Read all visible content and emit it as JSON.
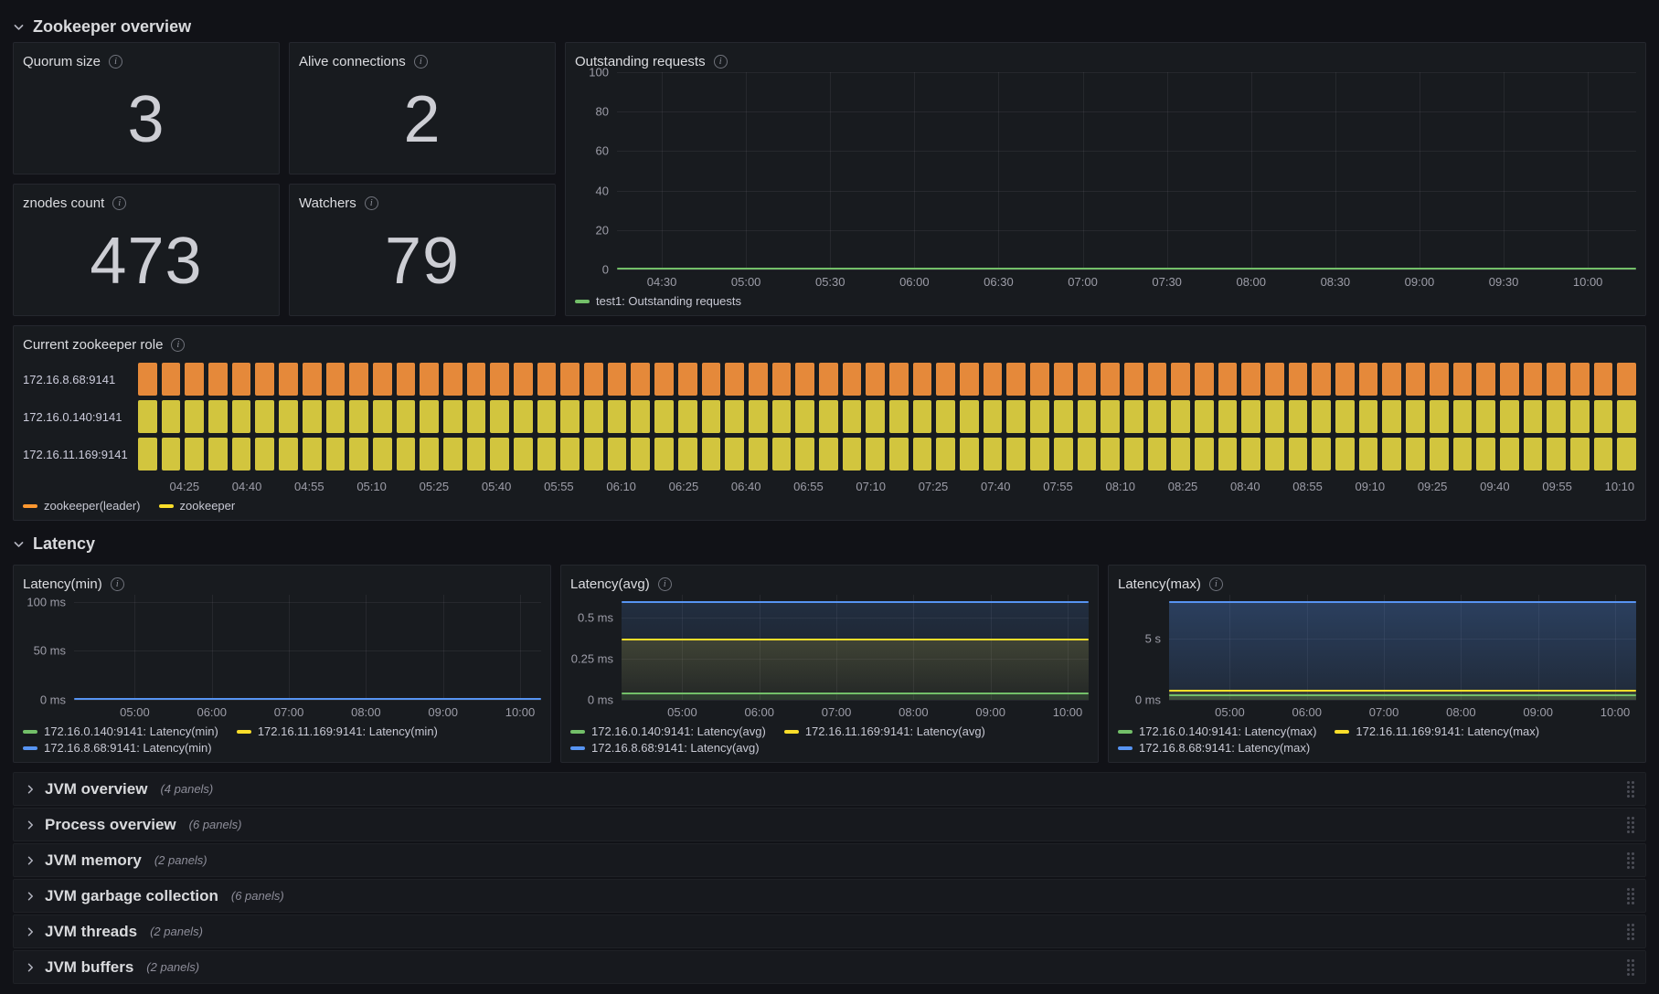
{
  "theme": {
    "background": "#111217",
    "panel_background": "#181b1f",
    "panel_border": "#25272e",
    "text_primary": "#ccccdc",
    "text_secondary": "#9d9da8",
    "grid_line": "rgba(204,204,220,0.08)",
    "series_green": "#73bf69",
    "series_yellow": "#fade2a",
    "series_orange": "#ff9830",
    "series_blue": "#5794f2"
  },
  "sections": {
    "overview": {
      "label": "Zookeeper overview"
    },
    "latency": {
      "label": "Latency"
    }
  },
  "stat_panels": [
    {
      "title": "Quorum size",
      "value": "3"
    },
    {
      "title": "Alive connections",
      "value": "2"
    },
    {
      "title": "znodes count",
      "value": "473"
    },
    {
      "title": "Watchers",
      "value": "79"
    }
  ],
  "outstanding_requests": {
    "title": "Outstanding requests",
    "y_ticks": [
      "100",
      "80",
      "60",
      "40",
      "20",
      "0"
    ],
    "x_ticks": [
      "04:30",
      "05:00",
      "05:30",
      "06:00",
      "06:30",
      "07:00",
      "07:30",
      "08:00",
      "08:30",
      "09:00",
      "09:30",
      "10:00"
    ],
    "legend": [
      {
        "label": "test1: Outstanding requests",
        "color": "#73bf69"
      }
    ],
    "chart_data": {
      "type": "line",
      "ylim": [
        0,
        100
      ],
      "series": [
        {
          "name": "test1: Outstanding requests",
          "value": 0
        }
      ]
    }
  },
  "zookeeper_role": {
    "title": "Current zookeeper role",
    "rows": [
      {
        "label": "172.16.8.68:9141",
        "state": "zookeeper(leader)",
        "fill": "#e5893a"
      },
      {
        "label": "172.16.0.140:9141",
        "state": "zookeeper",
        "fill": "#d2c53e"
      },
      {
        "label": "172.16.11.169:9141",
        "state": "zookeeper",
        "fill": "#d2c53e"
      }
    ],
    "x_ticks": [
      "04:25",
      "04:40",
      "04:55",
      "05:10",
      "05:25",
      "05:40",
      "05:55",
      "06:10",
      "06:25",
      "06:40",
      "06:55",
      "07:10",
      "07:25",
      "07:40",
      "07:55",
      "08:10",
      "08:25",
      "08:40",
      "08:55",
      "09:10",
      "09:25",
      "09:40",
      "09:55",
      "10:10"
    ],
    "legend": [
      {
        "label": "zookeeper(leader)",
        "color": "#ff9830"
      },
      {
        "label": "zookeeper",
        "color": "#fade2a"
      }
    ],
    "chart_data": {
      "type": "state-timeline",
      "states": [
        {
          "series": "172.16.8.68:9141",
          "state": "zookeeper(leader)"
        },
        {
          "series": "172.16.0.140:9141",
          "state": "zookeeper"
        },
        {
          "series": "172.16.11.169:9141",
          "state": "zookeeper"
        }
      ]
    }
  },
  "latency_min": {
    "title": "Latency(min)",
    "y_ticks": [
      "100 ms",
      "50 ms",
      "0 ms"
    ],
    "x_ticks": [
      "05:00",
      "06:00",
      "07:00",
      "08:00",
      "09:00",
      "10:00"
    ],
    "legend": [
      {
        "label": "172.16.0.140:9141: Latency(min)",
        "color": "#73bf69"
      },
      {
        "label": "172.16.11.169:9141: Latency(min)",
        "color": "#fade2a"
      },
      {
        "label": "172.16.8.68:9141: Latency(min)",
        "color": "#5794f2"
      }
    ],
    "chart_data": {
      "type": "line",
      "unit": "ms",
      "ylim": [
        0,
        100
      ],
      "series": [
        {
          "name": "172.16.0.140:9141",
          "value": 0
        },
        {
          "name": "172.16.11.169:9141",
          "value": 0
        },
        {
          "name": "172.16.8.68:9141",
          "value": 0
        }
      ]
    }
  },
  "latency_avg": {
    "title": "Latency(avg)",
    "y_ticks": [
      "0.5 ms",
      "0.25 ms",
      "0 ms"
    ],
    "x_ticks": [
      "05:00",
      "06:00",
      "07:00",
      "08:00",
      "09:00",
      "10:00"
    ],
    "legend": [
      {
        "label": "172.16.0.140:9141: Latency(avg)",
        "color": "#73bf69"
      },
      {
        "label": "172.16.11.169:9141: Latency(avg)",
        "color": "#fade2a"
      },
      {
        "label": "172.16.8.68:9141: Latency(avg)",
        "color": "#5794f2"
      }
    ],
    "chart_data": {
      "type": "line",
      "unit": "ms",
      "series": [
        {
          "name": "172.16.0.140:9141",
          "value": 0.03
        },
        {
          "name": "172.16.11.169:9141",
          "value": 0.37
        },
        {
          "name": "172.16.8.68:9141",
          "value": 0.58
        }
      ]
    }
  },
  "latency_max": {
    "title": "Latency(max)",
    "y_ticks": [
      "5 s",
      "0 ms"
    ],
    "x_ticks": [
      "05:00",
      "06:00",
      "07:00",
      "08:00",
      "09:00",
      "10:00"
    ],
    "legend": [
      {
        "label": "172.16.0.140:9141: Latency(max)",
        "color": "#73bf69"
      },
      {
        "label": "172.16.11.169:9141: Latency(max)",
        "color": "#fade2a"
      },
      {
        "label": "172.16.8.68:9141: Latency(max)",
        "color": "#5794f2"
      }
    ],
    "chart_data": {
      "type": "line",
      "unit": "s",
      "series": [
        {
          "name": "172.16.0.140:9141",
          "value": 0.4
        },
        {
          "name": "172.16.11.169:9141",
          "value": 0.8
        },
        {
          "name": "172.16.8.68:9141",
          "value": 8
        }
      ]
    }
  },
  "collapsed_sections": [
    {
      "label": "JVM overview",
      "count": "(4 panels)"
    },
    {
      "label": "Process overview",
      "count": "(6 panels)"
    },
    {
      "label": "JVM memory",
      "count": "(2 panels)"
    },
    {
      "label": "JVM garbage collection",
      "count": "(6 panels)"
    },
    {
      "label": "JVM threads",
      "count": "(2 panels)"
    },
    {
      "label": "JVM buffers",
      "count": "(2 panels)"
    }
  ]
}
